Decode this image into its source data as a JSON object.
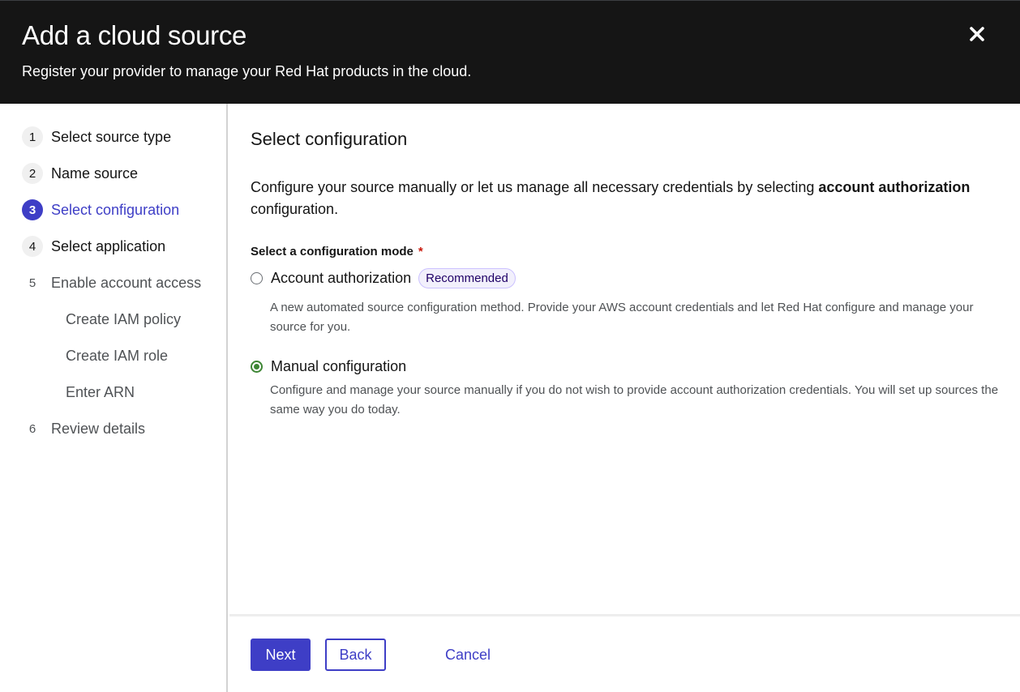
{
  "header": {
    "title": "Add a cloud source",
    "description": "Register your provider to manage your Red Hat products in the cloud.",
    "close_icon": "close-icon"
  },
  "nav": {
    "steps": [
      {
        "number": "1",
        "label": "Select source type",
        "state": "visited"
      },
      {
        "number": "2",
        "label": "Name source",
        "state": "visited"
      },
      {
        "number": "3",
        "label": "Select configuration",
        "state": "current"
      },
      {
        "number": "4",
        "label": "Select application",
        "state": "visited"
      },
      {
        "number": "5",
        "label": "Enable account access",
        "state": "upcoming",
        "substeps": [
          "Create IAM policy",
          "Create IAM role",
          "Enter ARN"
        ]
      },
      {
        "number": "6",
        "label": "Review details",
        "state": "upcoming"
      }
    ]
  },
  "main": {
    "title": "Select configuration",
    "intro_prefix": "Configure your source manually or let us manage all necessary credentials by selecting ",
    "intro_bold": "account authorization",
    "intro_suffix": " configuration.",
    "field_label": "Select a configuration mode",
    "required_marker": "*",
    "options": [
      {
        "label": "Account authorization",
        "badge": "Recommended",
        "checked": false,
        "description": "A new automated source configuration method. Provide your AWS account credentials and let Red Hat configure and manage your source for you."
      },
      {
        "label": "Manual configuration",
        "checked": true,
        "description": "Configure and manage your source manually if you do not wish to provide account authorization credentials. You will set up sources the same way you do today."
      }
    ]
  },
  "footer": {
    "next_label": "Next",
    "back_label": "Back",
    "cancel_label": "Cancel"
  },
  "colors": {
    "primary": "#3e3ec6",
    "header_bg": "#151515",
    "radio_checked": "#3e8635",
    "required": "#c9190b",
    "badge_bg": "#f2f0fc",
    "badge_border": "#cbc1ff",
    "badge_text": "#1f0066"
  }
}
